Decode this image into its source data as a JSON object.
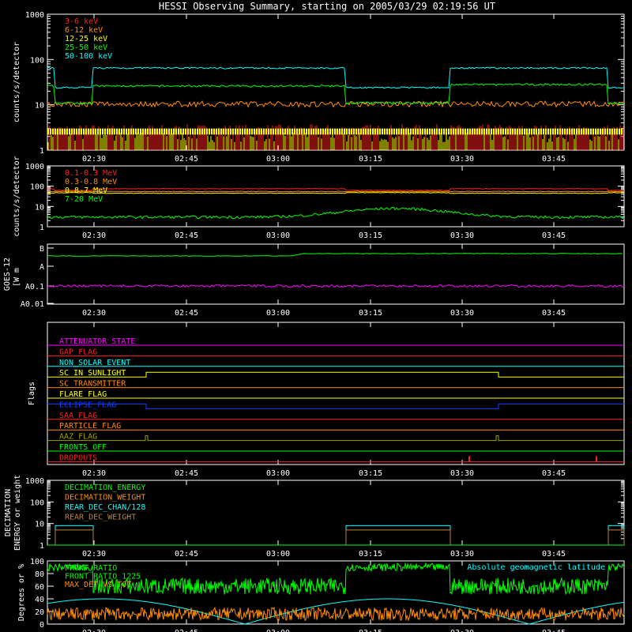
{
  "title": "HESSI Observing Summary, starting on 2005/03/29 02:19:56 UT",
  "time_ticks": [
    "02:30",
    "02:45",
    "03:00",
    "03:15",
    "03:30",
    "03:45"
  ],
  "colors": {
    "bg": "#000000",
    "axis": "#ffffff",
    "red": "#ff2020",
    "orange": "#ff8c00",
    "yellow": "#ffff00",
    "green": "#00ff00",
    "cyan": "#00ffff",
    "magenta": "#ff00ff",
    "blue": "#1040ff",
    "olive": "#a0a000",
    "brown": "#c08040"
  },
  "chart_data": [
    {
      "id": "lightcurves_low",
      "type": "line",
      "ylabel": "counts/s/detector",
      "yscale": "log",
      "ylim": [
        1,
        1000
      ],
      "ytick_labels": [
        "1",
        "10",
        "100",
        "1000"
      ],
      "legend_position": "top-left",
      "series": [
        {
          "name": "3-6 keV",
          "color": "#ff2020",
          "level": "~1-3, noisy"
        },
        {
          "name": "6-12 keV",
          "color": "#ff8c00",
          "level": "~10"
        },
        {
          "name": "12-25 keV",
          "color": "#ffff00",
          "level": "~2-3"
        },
        {
          "name": "25-50 keV",
          "color": "#00ff00",
          "level": "~11 (attenuated), ~25-30 (open)"
        },
        {
          "name": "50-100 keV",
          "color": "#00ffff",
          "level": "~25 (attenuated), ~65 (open)"
        }
      ]
    },
    {
      "id": "lightcurves_high",
      "type": "line",
      "ylabel": "counts/s/detector",
      "yscale": "log",
      "ylim": [
        1,
        1000
      ],
      "ytick_labels": [
        "1",
        "10",
        "100",
        "1000"
      ],
      "legend_position": "top-left",
      "series": [
        {
          "name": "0.1-0.3 MeV",
          "color": "#ff2020",
          "level": "~70-80"
        },
        {
          "name": "0.3-0.8 MeV",
          "color": "#ff8c00",
          "level": "~50-60"
        },
        {
          "name": "0.8-7 MeV",
          "color": "#ffff00",
          "level": "~45"
        },
        {
          "name": "7-20 MeV",
          "color": "#00ff00",
          "level": "~3-10"
        }
      ]
    },
    {
      "id": "goes",
      "type": "line",
      "ylabel_lines": [
        "GOES-12",
        "[W m",
        ""
      ],
      "ytick_labels": [
        "B",
        "A",
        "A0.1",
        "A0.01"
      ],
      "series": [
        {
          "color": "#00ff00",
          "level": "~A5, rising to ~A7 after 03:00"
        },
        {
          "color": "#ff00ff",
          "level": "~A0.1"
        }
      ]
    },
    {
      "id": "flags",
      "type": "line",
      "ylabel": "Flags",
      "flags": [
        {
          "name": "ATTENUATOR_STATE",
          "color": "#ff00ff"
        },
        {
          "name": "GAP_FLAG",
          "color": "#ff2020"
        },
        {
          "name": "NON_SOLAR_EVENT",
          "color": "#00ffff"
        },
        {
          "name": "SC_IN_SUNLIGHT",
          "color": "#ffff00"
        },
        {
          "name": "SC_TRANSMITTER",
          "color": "#ff8c00"
        },
        {
          "name": "FLARE_FLAG",
          "color": "#ffff00"
        },
        {
          "name": "ECLIPSE_FLAG",
          "color": "#1040ff"
        },
        {
          "name": "SAA_FLAG",
          "color": "#ff2020"
        },
        {
          "name": "PARTICLE_FLAG",
          "color": "#ff8c00"
        },
        {
          "name": "AAZ_FLAG",
          "color": "#a0a000"
        },
        {
          "name": "FRONTS_OFF",
          "color": "#00ff00"
        },
        {
          "name": "DROPOUTS",
          "color": "#ff2020"
        }
      ]
    },
    {
      "id": "decimation",
      "type": "line",
      "ylabel_lines": [
        "DECIMATION",
        "ENERGY or weight"
      ],
      "yscale": "log",
      "ytick_labels": [
        "1",
        "10",
        "100",
        "1000"
      ],
      "legend_position": "top-left",
      "series": [
        {
          "name": "DECIMATION_ENERGY",
          "color": "#00ff00"
        },
        {
          "name": "DECIMATION_WEIGHT",
          "color": "#ff8c00"
        },
        {
          "name": "REAR_DEC_CHAN/128",
          "color": "#00ffff"
        },
        {
          "name": "REAR_DEC_WEIGHT",
          "color": "#c08040"
        }
      ]
    },
    {
      "id": "ratios",
      "type": "line",
      "ylabel": "Degrees or %",
      "ylim": [
        0,
        100
      ],
      "ytick_labels": [
        "0",
        "20",
        "40",
        "60",
        "80",
        "100"
      ],
      "annotation": "Absolute geomagnetic latitude",
      "legend_position": "top-left",
      "series": [
        {
          "name": "FRONT_RATIO",
          "color": "#00ff00"
        },
        {
          "name": "FRONT_RATIO_1225",
          "color": "#00ff00"
        },
        {
          "name": "MAX_DET_VS_TOT",
          "color": "#ff8c00"
        },
        {
          "name": "Absolute geomagnetic latitude",
          "color": "#00ffff"
        }
      ]
    }
  ]
}
